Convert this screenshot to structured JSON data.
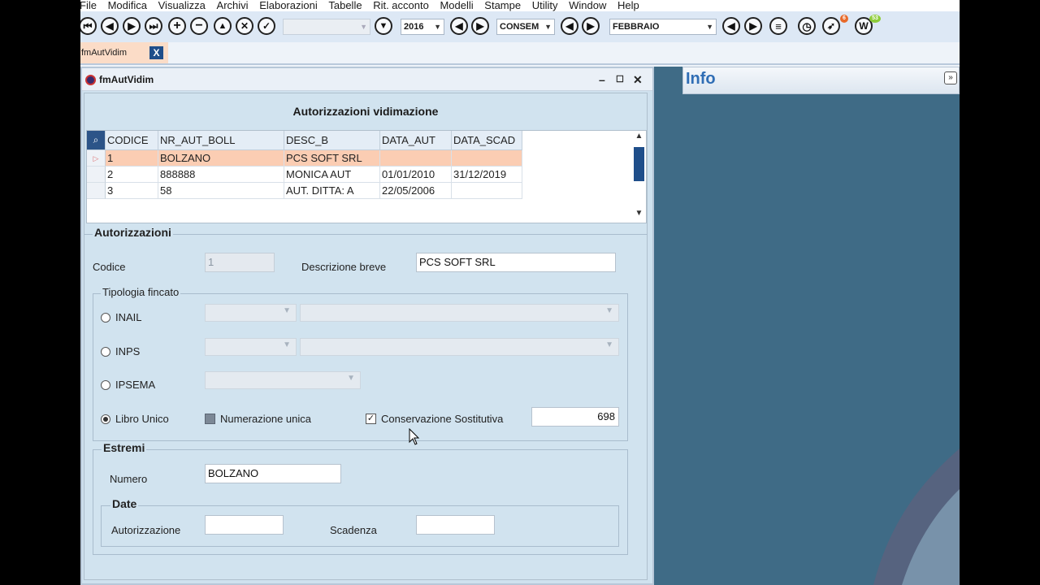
{
  "menu": [
    "File",
    "Modifica",
    "Visualizza",
    "Archivi",
    "Elaborazioni",
    "Tabelle",
    "Rit. acconto",
    "Modelli",
    "Stampe",
    "Utility",
    "Window",
    "Help"
  ],
  "toolbar": {
    "year": "2016",
    "type": "CONSEM",
    "month": "FEBBRAIO",
    "notif_badge": "6",
    "w_badge": "53"
  },
  "tab": {
    "label": "fmAutVidim",
    "close": "X"
  },
  "window": {
    "title": "fmAutVidim",
    "heading": "Autorizzazioni vidimazione"
  },
  "grid": {
    "columns": [
      "CODICE",
      "NR_AUT_BOLL",
      "DESC_B",
      "DATA_AUT",
      "DATA_SCAD"
    ],
    "rows": [
      [
        "1",
        "BOLZANO",
        "PCS SOFT SRL",
        "",
        ""
      ],
      [
        "2",
        "888888",
        "MONICA AUT",
        "01/01/2010",
        "31/12/2019"
      ],
      [
        "3",
        "58",
        "AUT. DITTA: A",
        "22/05/2006",
        ""
      ]
    ]
  },
  "form": {
    "group_title": "Autorizzazioni",
    "codice_label": "Codice",
    "codice_value": "1",
    "desc_label": "Descrizione breve",
    "desc_value": "PCS SOFT SRL",
    "tipologia_title": "Tipologia fincato",
    "options": [
      "INAIL",
      "INPS",
      "IPSEMA",
      "Libro Unico"
    ],
    "selected_option": "Libro Unico",
    "numerazione_label": "Numerazione unica",
    "conservazione_label": "Conservazione Sostitutiva",
    "conservazione_checked": true,
    "conservazione_value": "698",
    "estremi_title": "Estremi",
    "numero_label": "Numero",
    "numero_value": "BOLZANO",
    "date_title": "Date",
    "autorizzazione_label": "Autorizzazione",
    "autorizzazione_value": "",
    "scadenza_label": "Scadenza",
    "scadenza_value": ""
  },
  "info": {
    "title": "Info"
  },
  "colors": {
    "accent": "#1f4e8a",
    "selected_row": "#fbcdb3",
    "info_bg": "#3f6b86",
    "info_title": "#2f6db5"
  }
}
